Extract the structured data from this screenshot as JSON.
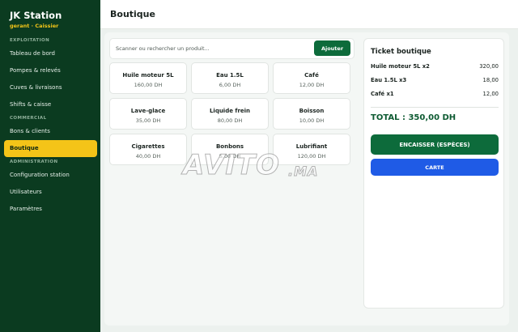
{
  "sidebar": {
    "brand": "JK Station",
    "role": "gerant · Caissier",
    "sections": [
      {
        "label": "EXPLOITATION",
        "items": [
          "Tableau de bord",
          "Pompes & relevés",
          "Cuves & livraisons",
          "Shifts & caisse"
        ]
      },
      {
        "label": "COMMERCIAL",
        "items": [
          "Bons & clients",
          "Boutique"
        ]
      },
      {
        "label": "ADMINISTRATION",
        "items": [
          "Configuration station",
          "Utilisateurs",
          "Paramètres"
        ]
      }
    ],
    "active_item": "Boutique"
  },
  "header": {
    "title": "Boutique"
  },
  "search": {
    "placeholder": "Scanner ou rechercher un produit...",
    "value": "",
    "button": "Ajouter"
  },
  "products": [
    {
      "name": "Huile moteur 5L",
      "price": "160,00 DH"
    },
    {
      "name": "Eau 1.5L",
      "price": "6,00 DH"
    },
    {
      "name": "Café",
      "price": "12,00 DH"
    },
    {
      "name": "Lave-glace",
      "price": "35,00 DH"
    },
    {
      "name": "Liquide frein",
      "price": "80,00 DH"
    },
    {
      "name": "Boisson",
      "price": "10,00 DH"
    },
    {
      "name": "Cigarettes",
      "price": "40,00 DH"
    },
    {
      "name": "Bonbons",
      "price": "5,00 DH"
    },
    {
      "name": "Lubrifiant",
      "price": "120,00 DH"
    }
  ],
  "ticket": {
    "title": "Ticket boutique",
    "lines": [
      {
        "label": "Huile moteur 5L  x2",
        "amount": "320,00"
      },
      {
        "label": "Eau 1.5L  x3",
        "amount": "18,00"
      },
      {
        "label": "Café  x1",
        "amount": "12,00"
      }
    ],
    "total": "TOTAL : 350,00 DH",
    "cash_button": "ENCAISSER (ESPÈCES)",
    "card_button": "CARTE"
  },
  "watermark": {
    "main": "AVITO",
    "suffix": ".MA"
  },
  "colors": {
    "sidebar": "#0b3b20",
    "accent": "#f4c418",
    "primary": "#0d6b3b",
    "card": "#1f5be6"
  }
}
